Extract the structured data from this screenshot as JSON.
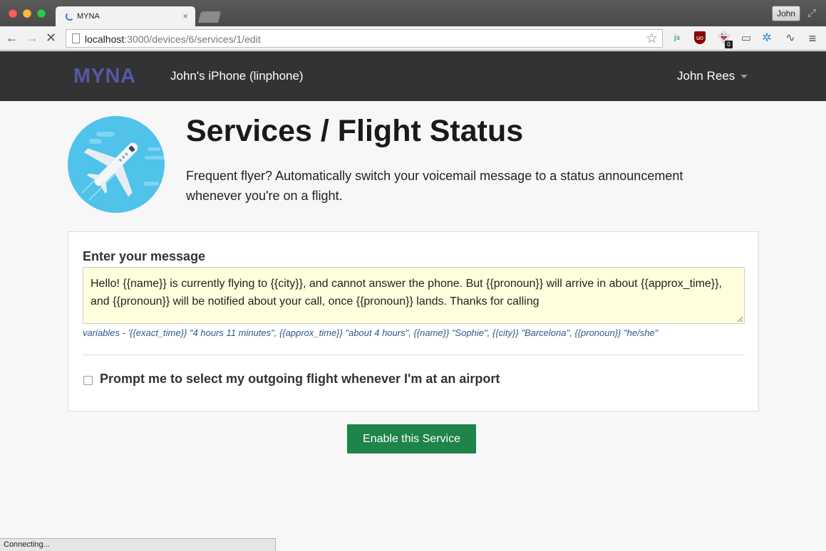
{
  "browser": {
    "tab_title": "MYNA",
    "tab_close": "×",
    "profile": "John",
    "url_host": "localhost",
    "url_path": ":3000/devices/6/services/1/edit",
    "status": "Connecting...",
    "extensions": {
      "js": "js",
      "ublock": "uo",
      "ghostery_badge": "0"
    }
  },
  "navbar": {
    "brand": "MYNA",
    "device": "John's iPhone (linphone)",
    "user": "John Rees"
  },
  "hero": {
    "title": "Services / Flight Status",
    "description": "Frequent flyer? Automatically switch your voicemail message to a status announcement whenever you're on a flight."
  },
  "form": {
    "message_label": "Enter your message",
    "message_value": "Hello! {{name}} is currently flying to {{city}}, and cannot answer the phone. But {{pronoun}} will arrive in about {{approx_time}}, and {{pronoun}} will be notified about your call, once {{pronoun}} lands. Thanks for calling",
    "variables_help": "variables - '{{exact_time}} \"4 hours 11 minutes\", {{approx_time}} \"about 4 hours\", {{name}} \"Sophie\", {{city}} \"Barcelona\", {{pronoun}} \"he/she\"",
    "checkbox_label": "Prompt me to select my outgoing flight whenever I'm at an airport",
    "checkbox_checked": false,
    "submit_label": "Enable this Service"
  },
  "colors": {
    "brand": "#5558a8",
    "navbar_bg": "#333333",
    "button_bg": "#1e8449",
    "textarea_bg": "#ffffdd",
    "icon_bg": "#4fc3ea"
  }
}
